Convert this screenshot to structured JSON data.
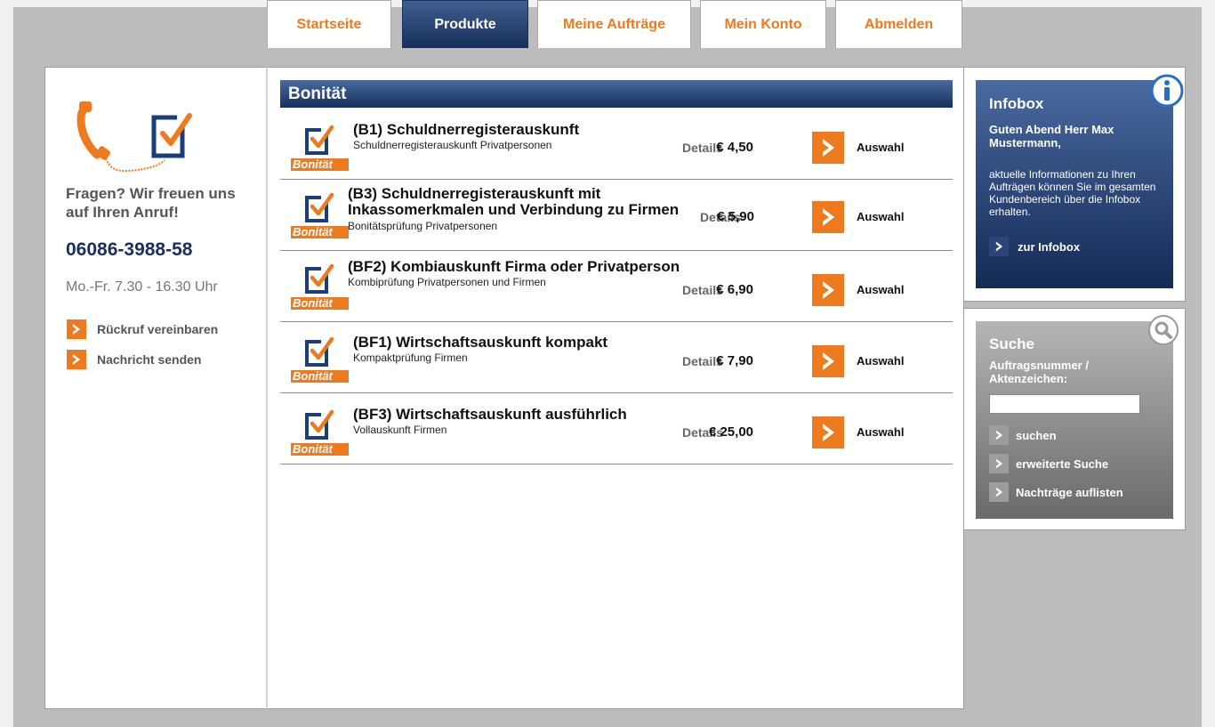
{
  "nav": {
    "tabs": [
      {
        "label": "Startseite",
        "active": false
      },
      {
        "label": "Produkte",
        "active": true
      },
      {
        "label": "Meine Aufträge",
        "active": false
      },
      {
        "label": "Mein Konto",
        "active": false
      },
      {
        "label": "Abmelden",
        "active": false
      }
    ]
  },
  "contact": {
    "question": "Fragen? Wir freuen uns auf Ihren Anruf!",
    "phone": "06086-3988-58",
    "hours": "Mo.-Fr. 7.30 - 16.30 Uhr",
    "links": [
      {
        "label": "Rückruf vereinbaren"
      },
      {
        "label": "Nachricht senden"
      }
    ]
  },
  "products": {
    "section_title": "Bonität",
    "badge_label": "Bonität",
    "details_label": "Details",
    "select_label": "Auswahl",
    "items": [
      {
        "title": "(B1) Schuldnerregisterauskunft",
        "subtitle": "Schuldnerregisterauskunft Privatpersonen",
        "price": "€ 4,50"
      },
      {
        "title": "(B3) Schuldnerregisterauskunft mit Inkassomerkmalen und Verbindung zu Firmen",
        "subtitle": "Bonitätsprüfung Privatpersonen",
        "price": "€ 5,90"
      },
      {
        "title": "(BF2) Kombiauskunft Firma oder Privatperson",
        "subtitle": "Kombiprüfung Privatpersonen und Firmen",
        "price": "€ 6,90"
      },
      {
        "title": "(BF1) Wirtschaftsauskunft kompakt",
        "subtitle": "Kompaktprüfung Firmen",
        "price": "€ 7,90"
      },
      {
        "title": "(BF3) Wirtschaftsauskunft ausführlich",
        "subtitle": "Vollauskunft Firmen",
        "price": "€ 25,00"
      }
    ]
  },
  "infobox": {
    "title": "Infobox",
    "greeting": "Guten Abend Herr Max Mustermann,",
    "text": "aktuelle Informationen zu Ihren Aufträgen können Sie im gesamten Kundenbereich über die Infobox erhalten.",
    "link": "zur Infobox"
  },
  "search": {
    "title": "Suche",
    "label": "Auftragsnummer / Aktenzeichen:",
    "value": "",
    "links": [
      {
        "label": "suchen"
      },
      {
        "label": "erweiterte Suche"
      },
      {
        "label": "Nachträge auflisten"
      }
    ]
  },
  "colors": {
    "accent": "#ee7a1f",
    "navy": "#17305c",
    "page_bg": "#bcbcbc"
  }
}
